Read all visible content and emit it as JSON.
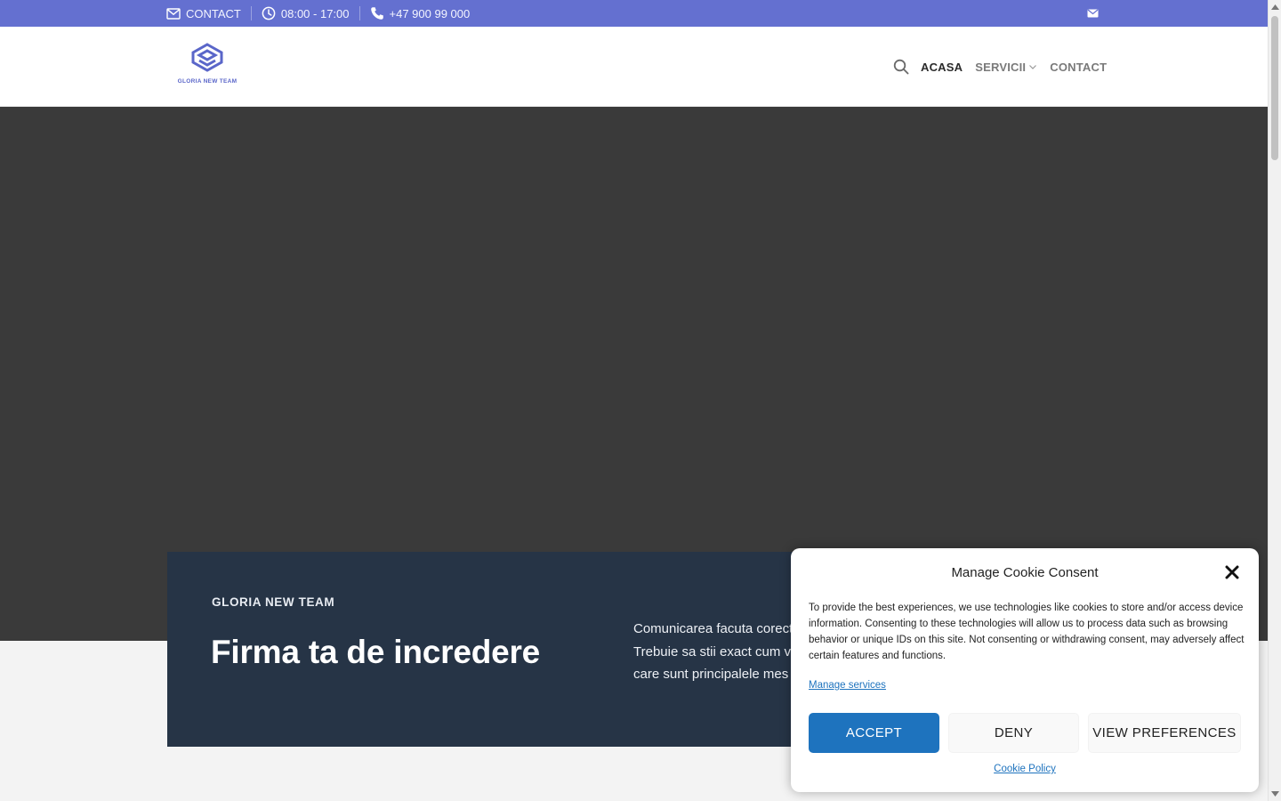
{
  "topbar": {
    "contact_label": "CONTACT",
    "hours": "08:00 - 17:00",
    "phone": "+47 900 99 000",
    "background": "#6470d0",
    "icons": [
      "envelope-icon",
      "clock-icon",
      "phone-icon",
      "envelope-small-icon"
    ]
  },
  "header": {
    "logo_text": "GLORIA NEW TEAM",
    "nav": [
      {
        "label": "ACASA",
        "active": true
      },
      {
        "label": "SERVICII",
        "active": false,
        "has_dropdown": true
      },
      {
        "label": "CONTACT",
        "active": false
      }
    ]
  },
  "intro": {
    "kicker": "GLORIA NEW TEAM",
    "title": "Firma ta de incredere",
    "text_lines": [
      "Comunicarea facuta corect",
      "Trebuie sa stii exact cum v",
      "care sunt principalele mes"
    ],
    "background": "#263446"
  },
  "cookie": {
    "title": "Manage Cookie Consent",
    "body": "To provide the best experiences, we use technologies like cookies to store and/or access device information. Consenting to these technologies will allow us to process data such as browsing behavior or unique IDs on this site. Not consenting or withdrawing consent, may adversely affect certain features and functions.",
    "manage_link": "Manage services",
    "accept": "ACCEPT",
    "deny": "DENY",
    "preferences": "VIEW PREFERENCES",
    "policy_link": "Cookie Policy",
    "accent": "#1e73be"
  }
}
